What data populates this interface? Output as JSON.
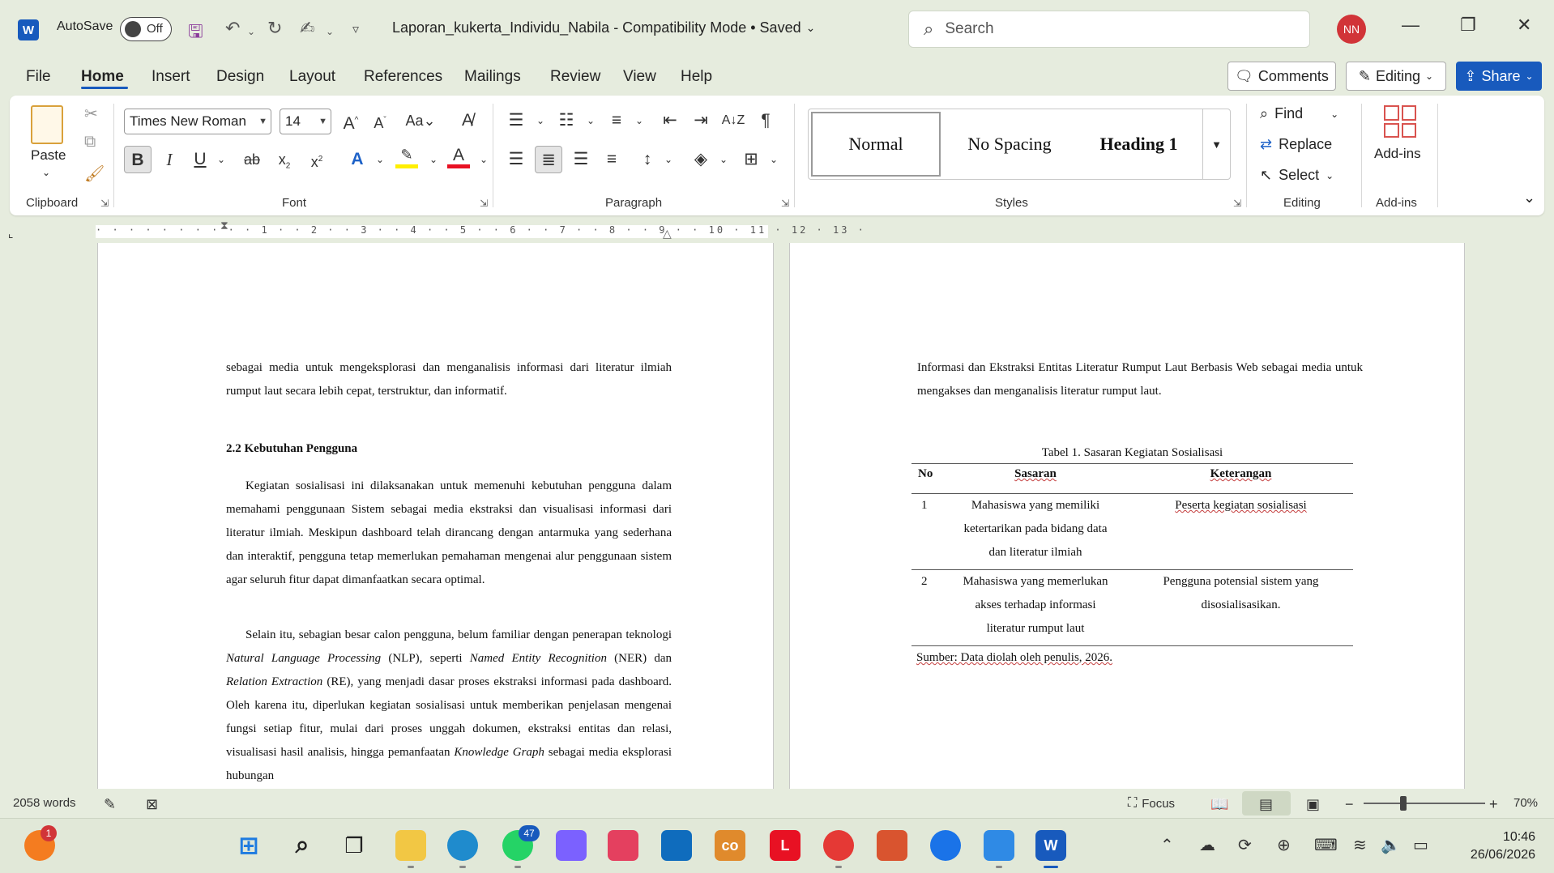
{
  "titlebar": {
    "autosave_label": "AutoSave",
    "autosave_state": "Off",
    "doc_title": "Laporan_kukerta_Individu_Nabila  -  Compatibility Mode • Saved",
    "search_placeholder": "Search",
    "user_initials": "NN"
  },
  "menu": {
    "tabs": [
      "File",
      "Home",
      "Insert",
      "Design",
      "Layout",
      "References",
      "Mailings",
      "Review",
      "View",
      "Help"
    ],
    "active_tab": "Home",
    "comments_label": "Comments",
    "editing_label": "Editing",
    "share_label": "Share"
  },
  "ribbon": {
    "clipboard": {
      "paste_label": "Paste",
      "group_label": "Clipboard"
    },
    "font": {
      "family": "Times New Roman",
      "size": "14",
      "group_label": "Font"
    },
    "paragraph": {
      "group_label": "Paragraph"
    },
    "styles": {
      "items": [
        "Normal",
        "No Spacing",
        "Heading 1"
      ],
      "selected": "Normal",
      "group_label": "Styles"
    },
    "editing": {
      "find_label": "Find",
      "replace_label": "Replace",
      "select_label": "Select",
      "group_label": "Editing"
    },
    "addins": {
      "button_label": "Add-ins",
      "group_label": "Add-ins"
    },
    "ruler_labels": "· · · · · · · · · · 1 · · 2 · · 3 · · 4 · · 5 · · 6 · · 7 · · 8 · · 9 · · 10 · 11 · 12 · 13 ·"
  },
  "document": {
    "left": {
      "intro_para": "sebagai media untuk mengeksplorasi dan menganalisis informasi dari literatur ilmiah rumput laut secara lebih cepat, terstruktur, dan informatif.",
      "heading": "2.2 Kebutuhan Pengguna",
      "para1": "Kegiatan sosialisasi ini dilaksanakan untuk memenuhi kebutuhan pengguna dalam memahami penggunaan Sistem sebagai media ekstraksi dan visualisasi informasi dari literatur ilmiah. Meskipun dashboard telah dirancang dengan antarmuka yang sederhana dan interaktif, pengguna tetap memerlukan pemahaman mengenai alur penggunaan sistem agar seluruh fitur dapat dimanfaatkan secara optimal.",
      "para2_a": "Selain itu, sebagian besar calon pengguna, belum familiar dengan penerapan teknologi ",
      "para2_i1": "Natural Language Processing",
      "para2_b": " (NLP), seperti ",
      "para2_i2": "Named Entity Recognition",
      "para2_c": " (NER) dan ",
      "para2_i3": "Relation Extraction",
      "para2_d": " (RE), yang menjadi dasar proses ekstraksi informasi pada dashboard. Oleh karena itu, diperlukan kegiatan sosialisasi untuk memberikan penjelasan mengenai fungsi setiap fitur, mulai dari proses unggah dokumen, ekstraksi entitas dan relasi, visualisasi hasil analisis, hingga pemanfaatan ",
      "para2_i4": "Knowledge Graph",
      "para2_e": " sebagai media eksplorasi hubungan"
    },
    "right": {
      "intro_para": "Informasi dan Ekstraksi Entitas Literatur Rumput Laut Berbasis Web sebagai media untuk mengakses dan menganalisis literatur rumput laut.",
      "table": {
        "caption": "Tabel 1. Sasaran Kegiatan Sosialisasi",
        "headers": [
          "No",
          "Sasaran",
          "Keterangan"
        ],
        "rows": [
          [
            "1",
            "Mahasiswa yang memiliki ketertarikan pada bidang data dan literatur ilmiah",
            "Peserta kegiatan sosialisasi"
          ],
          [
            "2",
            "Mahasiswa yang memerlukan akses terhadap informasi literatur rumput laut",
            "Pengguna potensial sistem yang disosialisasikan."
          ]
        ],
        "source": "Sumber: Data diolah oleh penulis, 2026."
      }
    }
  },
  "statusbar": {
    "word_count": "2058 words",
    "focus_label": "Focus",
    "zoom": "70%"
  },
  "taskbar": {
    "notification_badge": "1",
    "whatsapp_badge": "47",
    "time": "10:46",
    "date": "26/06/2026"
  },
  "colors": {
    "word_blue": "#185abd",
    "frame_green": "#e6ecde",
    "avatar_red": "#d13438"
  }
}
